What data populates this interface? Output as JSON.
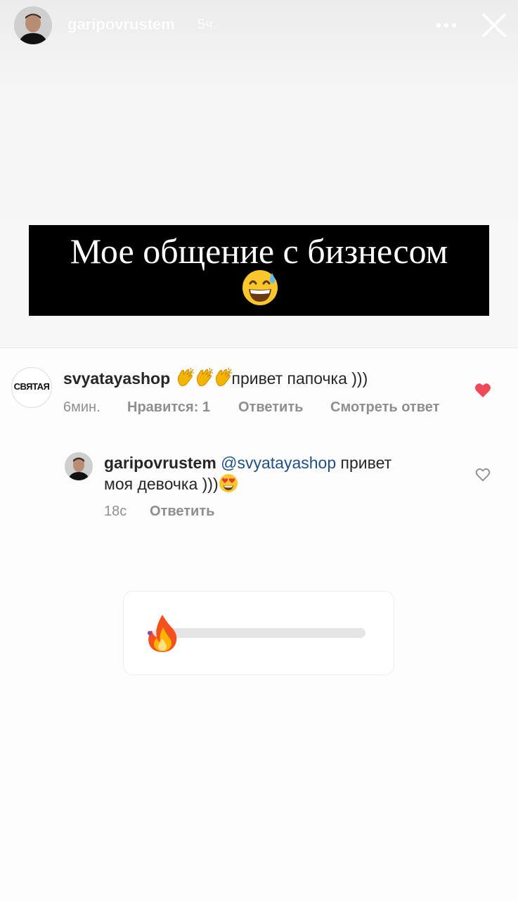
{
  "header": {
    "username": "garipovrustem",
    "time": "5ч.",
    "more_icon": "more-horizontal-icon",
    "close_icon": "close-icon"
  },
  "caption": {
    "text": "Мое общение с бизнесом",
    "emoji": "grinning-sweat-emoji"
  },
  "comments": [
    {
      "avatar_logo": "СВЯТАЯ",
      "username": "svyatayashop",
      "emoji": "clapping-hands-emoji",
      "emoji_count": 3,
      "text": "привет папочка )))",
      "time": "6мин.",
      "likes": "Нравится: 1",
      "reply": "Ответить",
      "view_reply": "Смотреть ответ",
      "liked": true
    },
    {
      "username": "garipovrustem",
      "mention": "@svyatayashop",
      "text_line1": "привет",
      "text_line2": "моя девочка )))",
      "emoji": "heart-eyes-emoji",
      "time": "18с",
      "reply": "Ответить",
      "liked": false
    }
  ],
  "slider": {
    "emoji": "fire-emoji",
    "value": 0.0
  },
  "colors": {
    "like_red": "#ed4956",
    "mention_blue": "#1f4f85",
    "meta_gray": "#8e8e8e"
  }
}
